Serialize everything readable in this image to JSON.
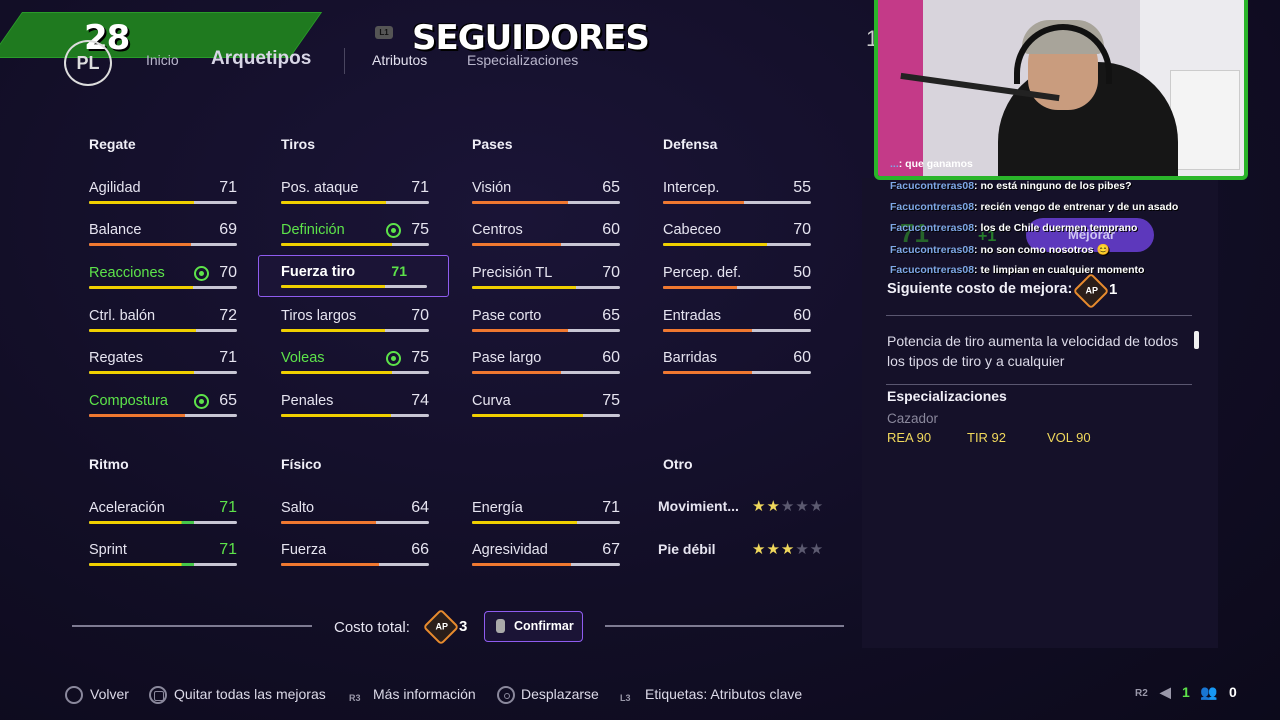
{
  "overlay": {
    "followers_count": "28",
    "followers_label": "SEGUIDORES"
  },
  "header": {
    "logo": "PL",
    "shoulder_left": "L1",
    "nav": {
      "inicio": "Inicio",
      "arquetipos": "Arquetipos",
      "atributos": "Atributos",
      "especializaciones": "Especializaciones",
      "right_cut": "1"
    }
  },
  "groups": {
    "regate": "Regate",
    "tiros": "Tiros",
    "pases": "Pases",
    "defensa": "Defensa",
    "ritmo": "Ritmo",
    "fisico": "Físico",
    "otro": "Otro"
  },
  "stats": {
    "agilidad": {
      "label": "Agilidad",
      "value": "71"
    },
    "balance": {
      "label": "Balance",
      "value": "69"
    },
    "reacciones": {
      "label": "Reacciones",
      "value": "70"
    },
    "ctrl_balon": {
      "label": "Ctrl. balón",
      "value": "72"
    },
    "regates": {
      "label": "Regates",
      "value": "71"
    },
    "compostura": {
      "label": "Compostura",
      "value": "65"
    },
    "pos_ataque": {
      "label": "Pos. ataque",
      "value": "71"
    },
    "definicion": {
      "label": "Definición",
      "value": "75"
    },
    "fuerza_tiro": {
      "label": "Fuerza tiro",
      "value": "71"
    },
    "tiros_largos": {
      "label": "Tiros largos",
      "value": "70"
    },
    "voleas": {
      "label": "Voleas",
      "value": "75"
    },
    "penales": {
      "label": "Penales",
      "value": "74"
    },
    "vision": {
      "label": "Visión",
      "value": "65"
    },
    "centros": {
      "label": "Centros",
      "value": "60"
    },
    "precision_tl": {
      "label": "Precisión TL",
      "value": "70"
    },
    "pase_corto": {
      "label": "Pase corto",
      "value": "65"
    },
    "pase_largo": {
      "label": "Pase largo",
      "value": "60"
    },
    "curva": {
      "label": "Curva",
      "value": "75"
    },
    "intercep": {
      "label": "Intercep.",
      "value": "55"
    },
    "cabeceo": {
      "label": "Cabeceo",
      "value": "70"
    },
    "percep_def": {
      "label": "Percep. def.",
      "value": "50"
    },
    "entradas": {
      "label": "Entradas",
      "value": "60"
    },
    "barridas": {
      "label": "Barridas",
      "value": "60"
    },
    "aceleracion": {
      "label": "Aceleración",
      "value": "71"
    },
    "sprint": {
      "label": "Sprint",
      "value": "71"
    },
    "salto": {
      "label": "Salto",
      "value": "64"
    },
    "fuerza": {
      "label": "Fuerza",
      "value": "66"
    },
    "energia": {
      "label": "Energía",
      "value": "71"
    },
    "agresividad": {
      "label": "Agresividad",
      "value": "67"
    }
  },
  "otro": {
    "movimientos": {
      "label": "Movimient...",
      "stars": 2,
      "max": 5
    },
    "pie_debil": {
      "label": "Pie débil",
      "stars": 3,
      "max": 5
    }
  },
  "footer": {
    "costo_label": "Costo total:",
    "costo_value": "3",
    "ap_label": "AP",
    "confirm": "Confirmar"
  },
  "hints": {
    "volver": "Volver",
    "quitar": "Quitar todas las mejoras",
    "mas_info": "Más información",
    "desplazarse": "Desplazarse",
    "etiquetas": "Etiquetas: Atributos clave",
    "r_label": "R",
    "r3_label": "R3",
    "l3_label": "L3",
    "r2_label": "R2",
    "count_1": "1",
    "count_0": "0"
  },
  "panel": {
    "next_cost_label": "Siguiente costo de mejora:",
    "next_cost_value": "1",
    "description": "Potencia de tiro aumenta la velocidad de todos los tipos de tiro y a cualquier",
    "spec_title": "Especializaciones",
    "spec_name": "Cazador",
    "spec_stats": [
      "REA 90",
      "TIR 92",
      "VOL 90"
    ]
  },
  "chat": {
    "first_user": "...",
    "first_text": ": que ganamos",
    "user": "Facucontreras08",
    "messages": [
      ": no está ninguno de los pibes?",
      ": recién vengo de entrenar y de un asado",
      ": los de Chile duermen temprano",
      ": no son como nosotros 😊",
      ": te limpian en cualquier momento"
    ],
    "ghost_num": "71",
    "ghost_plus": "+1",
    "pill_label": "Mejorar"
  },
  "colors": {
    "accent_purple": "#8f5cf0",
    "green": "#5de34a",
    "bar_yellow": "#f0d000",
    "bar_orange": "#f07830",
    "bar_green": "#46c84a"
  }
}
